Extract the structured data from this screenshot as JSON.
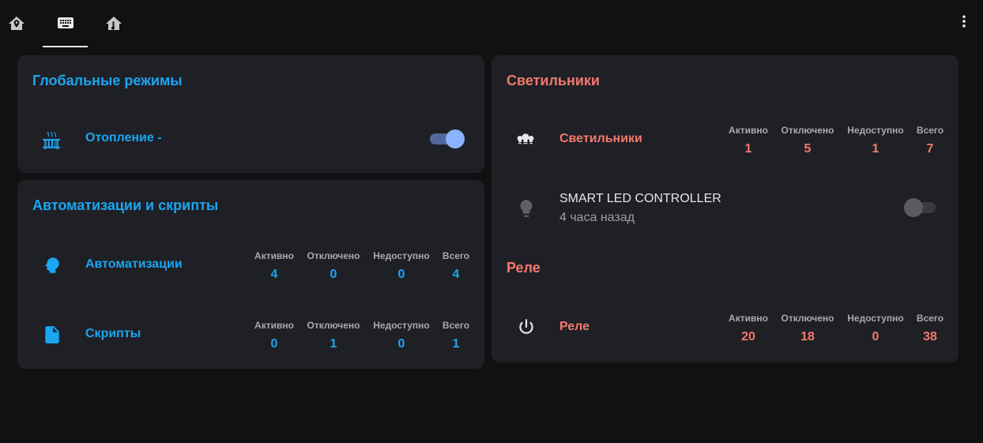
{
  "colors": {
    "accent_blue": "#1aa6f0",
    "accent_red": "#f2796b",
    "card_bg": "#1f2026",
    "page_bg": "#111111",
    "toggle_on": "#8ab2ff"
  },
  "toolbar": {
    "tabs": [
      {
        "icon": "home-map-marker-icon",
        "active": false
      },
      {
        "icon": "keyboard-icon",
        "active": true
      },
      {
        "icon": "home-thermometer-icon",
        "active": false
      }
    ],
    "menu_icon": "dots-vertical-icon"
  },
  "global_modes": {
    "title": "Глобальные режимы",
    "rows": [
      {
        "icon": "radiator-icon",
        "label": "Отопление -",
        "toggle_on": true
      }
    ]
  },
  "automations": {
    "title": "Автоматизации и скрипты",
    "rows": [
      {
        "icon": "robot-head-icon",
        "label": "Автоматизации",
        "stats": [
          {
            "head": "Активно",
            "value": "4"
          },
          {
            "head": "Отключено",
            "value": "0"
          },
          {
            "head": "Недоступно",
            "value": "0"
          },
          {
            "head": "Всего",
            "value": "4"
          }
        ]
      },
      {
        "icon": "script-file-icon",
        "label": "Скрипты",
        "stats": [
          {
            "head": "Активно",
            "value": "0"
          },
          {
            "head": "Отключено",
            "value": "1"
          },
          {
            "head": "Недоступно",
            "value": "0"
          },
          {
            "head": "Всего",
            "value": "1"
          }
        ]
      }
    ]
  },
  "lights": {
    "title": "Светильники",
    "group": {
      "icon": "lightbulb-group-icon",
      "label": "Светильники",
      "stats": [
        {
          "head": "Активно",
          "value": "1"
        },
        {
          "head": "Отключено",
          "value": "5"
        },
        {
          "head": "Недоступно",
          "value": "1"
        },
        {
          "head": "Всего",
          "value": "7"
        }
      ]
    },
    "entity": {
      "icon": "lightbulb-icon",
      "name": "SMART LED CONTROLLER",
      "secondary": "4 часа назад",
      "toggle_on": false
    }
  },
  "relays": {
    "title": "Реле",
    "group": {
      "icon": "power-icon",
      "label": "Реле",
      "stats": [
        {
          "head": "Активно",
          "value": "20"
        },
        {
          "head": "Отключено",
          "value": "18"
        },
        {
          "head": "Недоступно",
          "value": "0"
        },
        {
          "head": "Всего",
          "value": "38"
        }
      ]
    }
  }
}
